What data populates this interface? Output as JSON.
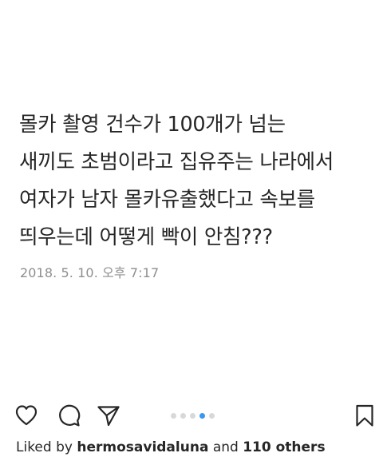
{
  "post": {
    "lines": [
      "몰카 촬영 건수가 100개가 넘는",
      "새끼도 초범이라고 집유주는 나라에서",
      "여자가 남자 몰카유출했다고 속보를",
      "띄우는데 어떻게 빡이 안침???"
    ],
    "date": "2018. 5. 10. 오후 7:17"
  },
  "actions": {
    "icons": [
      "heart-icon",
      "comment-icon",
      "share-icon",
      "bookmark-icon"
    ],
    "carousel": {
      "total": 5,
      "active_index": 3,
      "active_color": "#3897f0",
      "inactive_color": "#d8d8d8"
    }
  },
  "likes": {
    "prefix": "Liked by",
    "user": "hermosavidaluna",
    "middle": "and",
    "others": "110 others"
  }
}
